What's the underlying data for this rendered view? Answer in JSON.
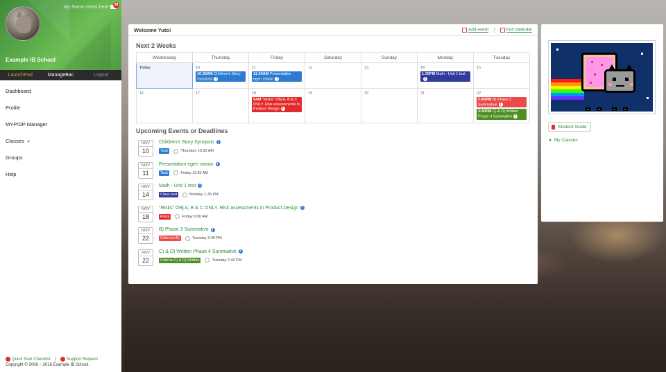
{
  "user": {
    "name": "My Name Goes here",
    "unread_count": "38"
  },
  "school": {
    "name": "Example IB School"
  },
  "sidebar_tabs": [
    "LaunchPad",
    "ManageBac",
    "Logout"
  ],
  "nav": [
    {
      "label": "Dashboard"
    },
    {
      "label": "Profile"
    },
    {
      "label": "MYP/DP Manager"
    },
    {
      "label": "Classes"
    },
    {
      "label": "Groups"
    },
    {
      "label": "Help"
    }
  ],
  "footer": {
    "checklist": "Quick Start Checklist",
    "support": "Support Request",
    "copyright": "Copyright © 2006 ~ 2016 Example IB School."
  },
  "main": {
    "welcome": "Welcome Yuto!",
    "add_event": "Add event",
    "full_calendar": "Full calendar",
    "next_title": "Next 2 Weeks",
    "upcoming_title": "Upcoming Events or Deadlines"
  },
  "calendar": {
    "days": [
      "Wednesday",
      "Thursday",
      "Friday",
      "Saturday",
      "Sunday",
      "Monday",
      "Tuesday"
    ],
    "weeks": [
      [
        {
          "date": "Today",
          "today": true,
          "events": []
        },
        {
          "date": "10",
          "events": [
            {
              "time": "10:30AM",
              "title": "Children's Story Synopsis",
              "color": "#2d7bd1"
            }
          ]
        },
        {
          "date": "11",
          "events": [
            {
              "time": "11:30AM",
              "title": "Presentation egen roman",
              "color": "#2d7bd1"
            }
          ]
        },
        {
          "date": "12",
          "events": []
        },
        {
          "date": "13",
          "events": []
        },
        {
          "date": "14",
          "events": [
            {
              "time": "1:35PM",
              "title": "Math - Unit 1 test",
              "color": "#2f3c9c"
            }
          ]
        },
        {
          "date": "15",
          "events": []
        }
      ],
      [
        {
          "date": "16",
          "events": []
        },
        {
          "date": "17",
          "events": []
        },
        {
          "date": "18",
          "events": [
            {
              "time": "9AM",
              "title": "\"Risks\" OBj A, B & C ONLY. Risk assessments in Product Design",
              "color": "#e32a2a"
            }
          ]
        },
        {
          "date": "19",
          "events": []
        },
        {
          "date": "20",
          "events": []
        },
        {
          "date": "21",
          "events": []
        },
        {
          "date": "22",
          "events": [
            {
              "time": "2:40PM",
              "title": "B) Phase 3 Summative",
              "color": "#ea4a4a"
            },
            {
              "time": "2:40PM",
              "title": "C) & D) Written Phase 4 Summative",
              "color": "#4c8f22"
            }
          ]
        }
      ]
    ]
  },
  "upcoming": [
    {
      "month": "NOV",
      "day": "10",
      "title": "Children's Story Synopsis",
      "tag": "Task",
      "tag_color": "#2d7bd1",
      "when": "Thursday 10:30 AM"
    },
    {
      "month": "NOV",
      "day": "11",
      "title": "Presentation egen roman",
      "tag": "Task",
      "tag_color": "#2d7bd1",
      "when": "Friday 11:30 AM"
    },
    {
      "month": "NOV",
      "day": "14",
      "title": "Math - Unit 1 test",
      "tag": "Class test",
      "tag_color": "#2f3c9c",
      "when": "Monday 1:35 PM"
    },
    {
      "month": "NOV",
      "day": "18",
      "title": "\"Risks\" OBj A, B & C ONLY. Risk assessments in Product Design",
      "tag": "Risks",
      "tag_color": "#e32a2a",
      "when": "Friday 9:00 AM"
    },
    {
      "month": "NOV",
      "day": "22",
      "title": "B) Phase 3 Summative",
      "tag": "Criterion B)",
      "tag_color": "#ea4a4a",
      "when": "Tuesday 2:40 PM"
    },
    {
      "month": "NOV",
      "day": "22",
      "title": "C) & D) Written Phase 4 Summative",
      "tag": "Criteria C) & D) Written",
      "tag_color": "#4c8f22",
      "when": "Tuesday 2:40 PM"
    }
  ],
  "right": {
    "image_icon": "nyan-cat-image",
    "student_guide": "Student Guide",
    "my_classes": "My Classes"
  },
  "colors": {
    "brand_green": "#2e8b3a",
    "sidebar_dark": "#2b2b2b",
    "badge_red": "#d9302c"
  }
}
